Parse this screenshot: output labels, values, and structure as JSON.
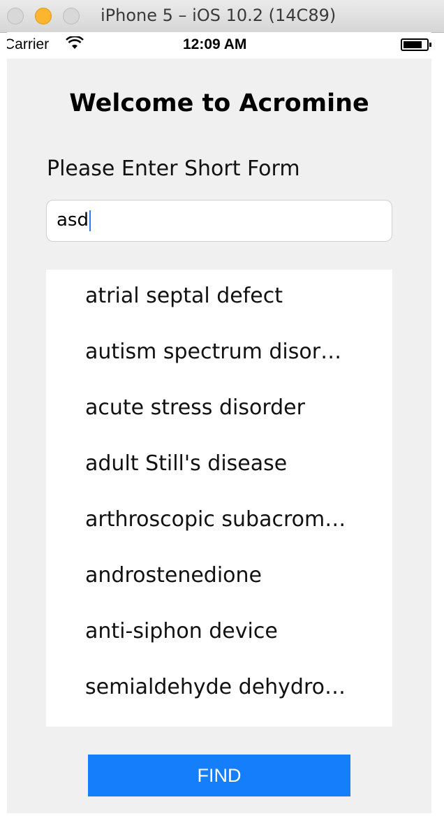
{
  "window": {
    "title": "iPhone 5 – iOS 10.2 (14C89)"
  },
  "status_bar": {
    "carrier": "Carrier",
    "time": "12:09 AM",
    "wifi_icon": "wifi-icon",
    "battery_icon": "battery-icon"
  },
  "main": {
    "welcome": "Welcome to Acromine",
    "prompt": "Please Enter Short Form",
    "input_value": "asd",
    "results": [
      "atrial septal defect",
      "autism spectrum disor…",
      "acute stress disorder",
      "adult Still's disease",
      "arthroscopic subacrom…",
      "androstenedione",
      "anti-siphon device",
      "semialdehyde dehydro…"
    ],
    "find_label": "FIND"
  },
  "colors": {
    "accent": "#147efb",
    "background": "#f0f0f0",
    "caret": "#2f7bf5"
  }
}
